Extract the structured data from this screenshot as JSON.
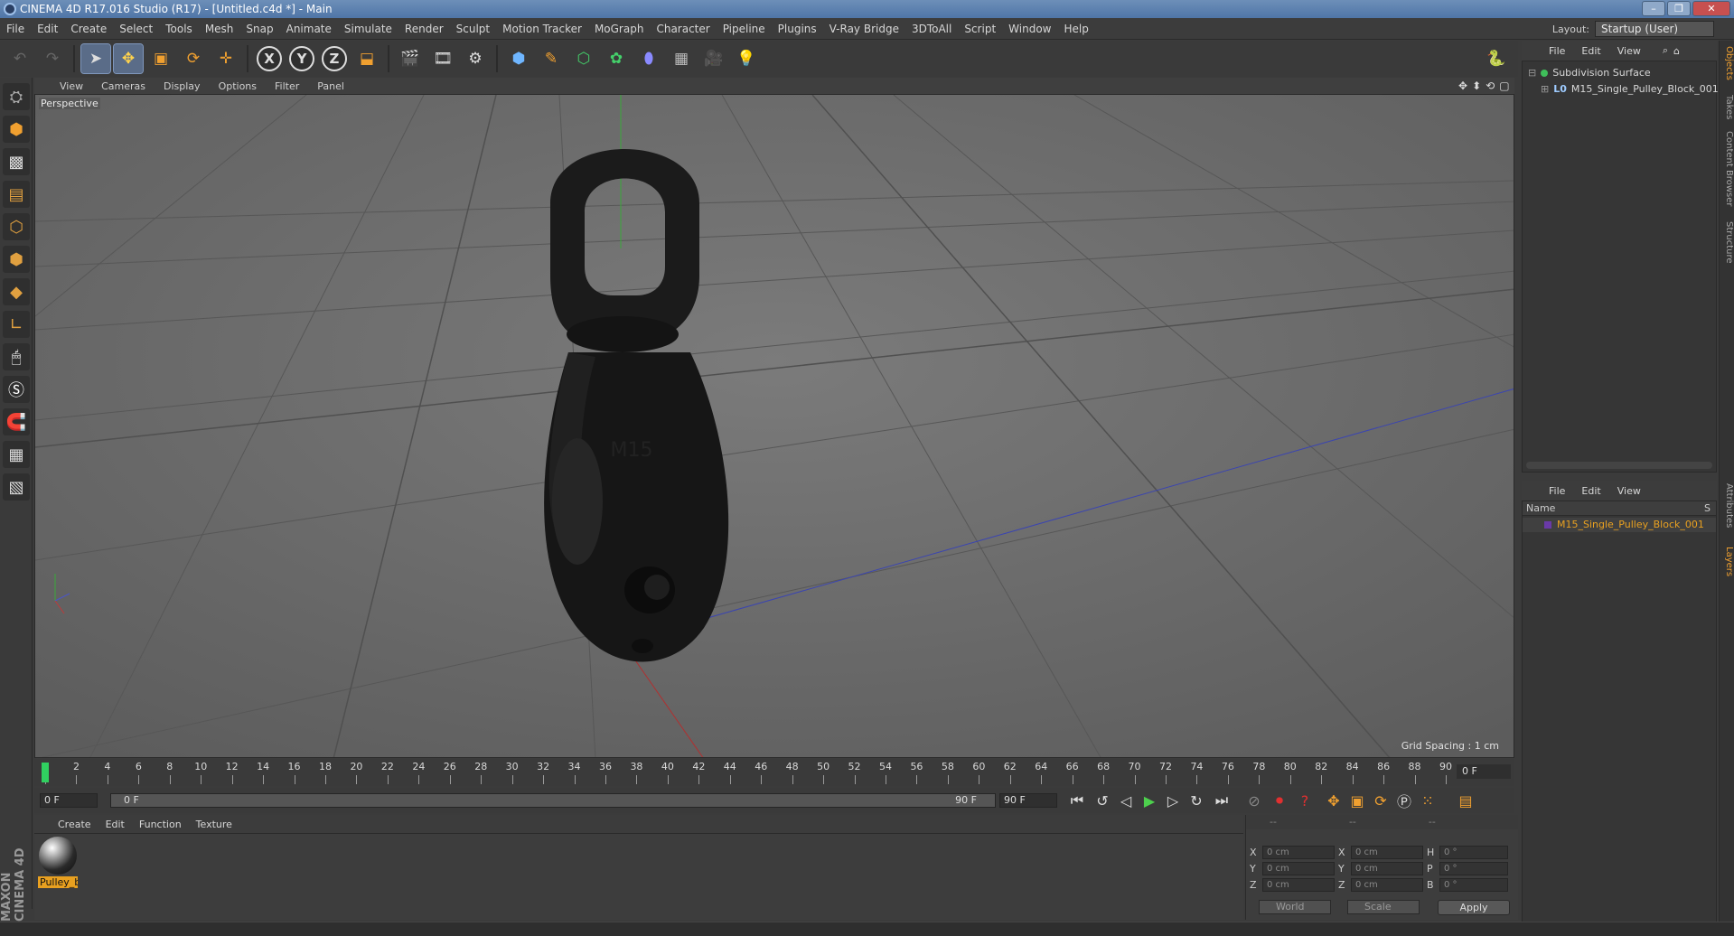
{
  "window": {
    "title": "CINEMA 4D R17.016 Studio (R17) - [Untitled.c4d *] - Main",
    "buttons": [
      "–",
      "❐",
      "✕"
    ]
  },
  "menubar": {
    "items": [
      "File",
      "Edit",
      "Create",
      "Select",
      "Tools",
      "Mesh",
      "Snap",
      "Animate",
      "Simulate",
      "Render",
      "Sculpt",
      "Motion Tracker",
      "MoGraph",
      "Character",
      "Pipeline",
      "Plugins",
      "V-Ray Bridge",
      "3DToAll",
      "Script",
      "Window",
      "Help"
    ],
    "layout_label": "Layout:",
    "layout_value": "Startup (User)"
  },
  "viewport": {
    "menu": [
      "View",
      "Cameras",
      "Display",
      "Options",
      "Filter",
      "Panel"
    ],
    "label": "Perspective",
    "grid_spacing": "Grid Spacing : 1 cm",
    "model_text": "M15"
  },
  "timeline": {
    "ticks": [
      "0",
      "2",
      "4",
      "6",
      "8",
      "10",
      "12",
      "14",
      "16",
      "18",
      "20",
      "22",
      "24",
      "26",
      "28",
      "30",
      "32",
      "34",
      "36",
      "38",
      "40",
      "42",
      "44",
      "46",
      "48",
      "50",
      "52",
      "54",
      "56",
      "58",
      "60",
      "62",
      "64",
      "66",
      "68",
      "70",
      "72",
      "74",
      "76",
      "78",
      "80",
      "82",
      "84",
      "86",
      "88",
      "90"
    ],
    "current_frame": "0 F"
  },
  "transport": {
    "start_field": "0 F",
    "range_start": "0 F",
    "range_end": "90 F",
    "end_field": "90 F"
  },
  "material_manager": {
    "menu": [
      "Create",
      "Edit",
      "Function",
      "Texture"
    ],
    "material_name": "Pulley_b"
  },
  "coordinates": {
    "headers": [
      "--",
      "--",
      "--"
    ],
    "rows": [
      {
        "a": "X",
        "av": "0 cm",
        "b": "X",
        "bv": "0 cm",
        "c": "H",
        "cv": "0 °"
      },
      {
        "a": "Y",
        "av": "0 cm",
        "b": "Y",
        "bv": "0 cm",
        "c": "P",
        "cv": "0 °"
      },
      {
        "a": "Z",
        "av": "0 cm",
        "b": "Z",
        "bv": "0 cm",
        "c": "B",
        "cv": "0 °"
      }
    ],
    "mode_select": "World",
    "scale_select": "Scale",
    "apply": "Apply"
  },
  "object_manager": {
    "menu": [
      "File",
      "Edit",
      "View"
    ],
    "objects": [
      "Subdivision Surface",
      "M15_Single_Pulley_Block_001"
    ],
    "layer_tag": "L0"
  },
  "layer_manager": {
    "menu": [
      "File",
      "Edit",
      "View"
    ],
    "column_name": "Name",
    "column_s": "S",
    "layers": [
      "M15_Single_Pulley_Block_001"
    ]
  },
  "side_tabs": [
    "Objects",
    "Takes",
    "Content Browser",
    "Structure",
    "Attributes",
    "Layers"
  ],
  "branding": "MAXON CINEMA 4D",
  "colors": {
    "accent": "#e8a020",
    "selection": "#5a6c88",
    "title_bar": "#5a7fb0"
  }
}
